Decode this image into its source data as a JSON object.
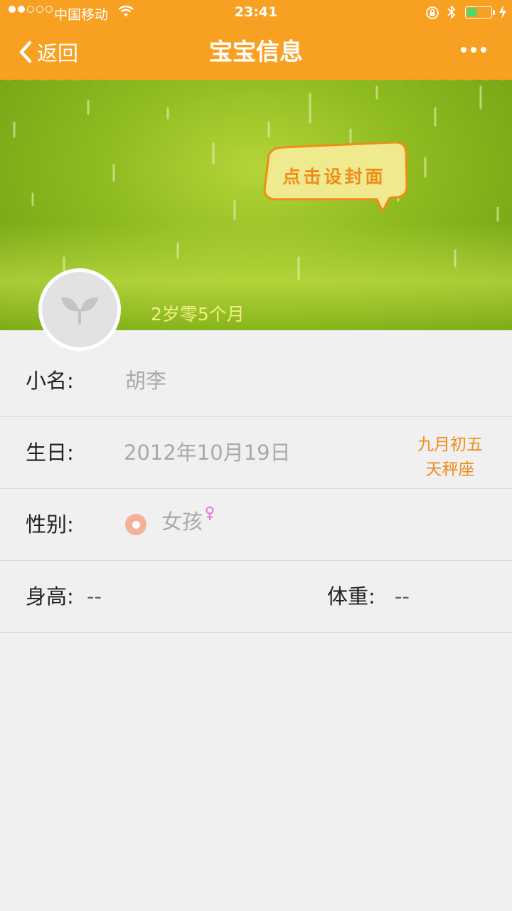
{
  "status_bar": {
    "carrier": "中国移动",
    "time": "23:41",
    "signal_bars_filled": 2,
    "signal_bars_total": 5,
    "battery_level": 0.45,
    "battery_color": "#4cd964"
  },
  "nav": {
    "back_label": "返回",
    "title": "宝宝信息",
    "background": "#f7a022"
  },
  "cover": {
    "hint": "点击设封面",
    "age": "2岁零5个月"
  },
  "fields": {
    "nickname_label": "小名:",
    "nickname_value": "胡李",
    "birthday_label": "生日:",
    "birthday_value": "2012年10月19日",
    "lunar_date": "九月初五",
    "zodiac": "天秤座",
    "gender_label": "性别:",
    "gender_value": "女孩",
    "height_label": "身高:",
    "height_value": "--",
    "weight_label": "体重:",
    "weight_value": "--"
  },
  "colors": {
    "accent": "#f08c1a",
    "radio": "#f5b098",
    "female_symbol": "#e07ad8"
  },
  "icons": [
    "wifi-icon",
    "orientation-lock-icon",
    "bluetooth-icon",
    "battery-icon",
    "charging-bolt-icon",
    "back-chevron-icon",
    "more-icon",
    "sprout-icon",
    "female-icon"
  ]
}
